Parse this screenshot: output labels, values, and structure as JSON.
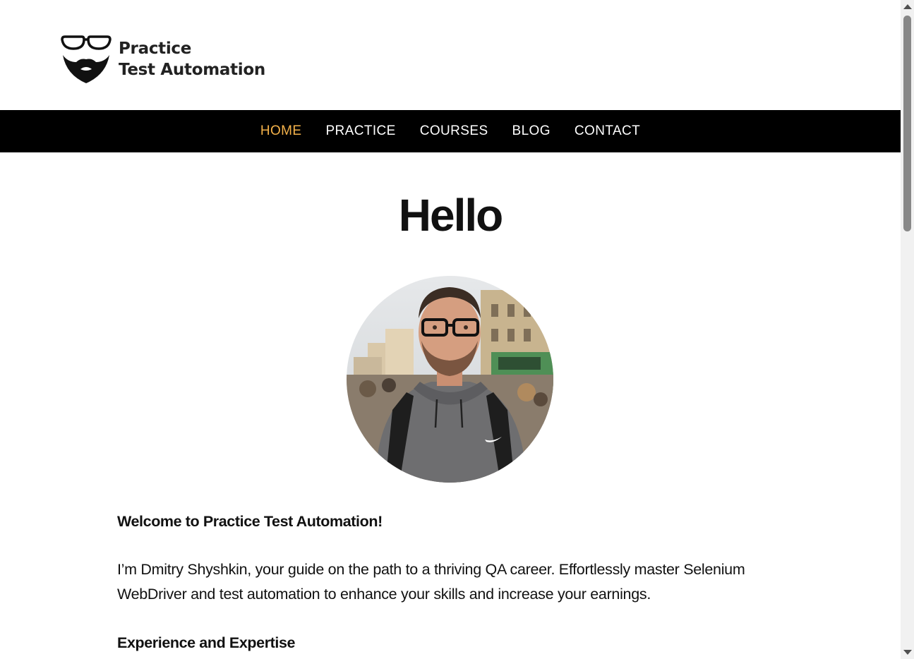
{
  "site": {
    "logo_line1": "Practice",
    "logo_line2": "Test Automation"
  },
  "nav": {
    "items": [
      {
        "label": "HOME",
        "active": true
      },
      {
        "label": "PRACTICE"
      },
      {
        "label": "COURSES"
      },
      {
        "label": "BLOG"
      },
      {
        "label": "CONTACT"
      }
    ],
    "active_color": "#f4b24a"
  },
  "main": {
    "title": "Hello",
    "welcome": "Welcome to Practice Test Automation!",
    "intro_line1": "I’m Dmitry Shyshkin, your guide on the path to a thriving QA career. Effortlessly master Selenium",
    "intro_line2": "WebDriver and test automation to enhance your skills and increase your earnings.",
    "experience_heading": "Experience and Expertise"
  },
  "icons": {
    "logo": "glasses-beard-logo-icon",
    "portrait": "profile-photo"
  }
}
